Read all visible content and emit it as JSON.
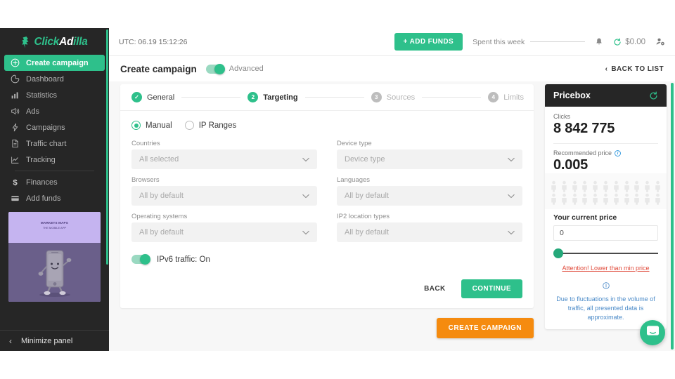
{
  "brand": {
    "accent": "#2ec08b",
    "orange": "#f58b0f",
    "dark": "#262626",
    "logo_click": "Click",
    "logo_ad": "Ad",
    "logo_illa": "illa"
  },
  "sidebar": {
    "items": [
      {
        "label": "Create campaign",
        "icon": "plus-circle-icon",
        "active": true
      },
      {
        "label": "Dashboard",
        "icon": "pie-chart-icon",
        "active": false
      },
      {
        "label": "Statistics",
        "icon": "bar-chart-icon",
        "active": false
      },
      {
        "label": "Ads",
        "icon": "megaphone-icon",
        "active": false
      },
      {
        "label": "Campaigns",
        "icon": "bolt-icon",
        "active": false
      },
      {
        "label": "Traffic chart",
        "icon": "document-icon",
        "active": false
      },
      {
        "label": "Tracking",
        "icon": "line-chart-icon",
        "active": false
      },
      {
        "label": "Finances",
        "icon": "dollar-icon",
        "active": false
      },
      {
        "label": "Add funds",
        "icon": "credit-card-icon",
        "active": false
      }
    ],
    "promo": {
      "line1": "MARKETS MAPS",
      "line2": "THE MOBILE APP"
    },
    "minimize_label": "Minimize panel"
  },
  "topbar": {
    "utc": "UTC: 06.19 15:12:26",
    "add_funds_label": "+ ADD FUNDS",
    "spent_label": "Spent this week",
    "spent_value": "",
    "balance": "$0.00",
    "bell_icon": "bell-icon",
    "refresh_icon": "refresh-icon",
    "account_icon": "account-settings-icon"
  },
  "pagehead": {
    "title": "Create campaign",
    "advanced_label": "Advanced",
    "advanced_on": true,
    "back_to_list": "BACK TO LIST"
  },
  "stepper": [
    {
      "num": "✓",
      "label": "General",
      "state": "done"
    },
    {
      "num": "2",
      "label": "Targeting",
      "state": "cur"
    },
    {
      "num": "3",
      "label": "Sources",
      "state": "idle"
    },
    {
      "num": "4",
      "label": "Limits",
      "state": "idle"
    }
  ],
  "form": {
    "mode_options": [
      {
        "label": "Manual",
        "selected": true
      },
      {
        "label": "IP Ranges",
        "selected": false
      }
    ],
    "fields": [
      {
        "label": "Countries",
        "value": "All selected"
      },
      {
        "label": "Device type",
        "value": "Device type"
      },
      {
        "label": "Browsers",
        "value": "All by default"
      },
      {
        "label": "Languages",
        "value": "All by default"
      },
      {
        "label": "Operating systems",
        "value": "All by default"
      },
      {
        "label": "IP2 location types",
        "value": "All by default"
      }
    ],
    "ipv6_label": "IPv6 traffic: On",
    "ipv6_on": true,
    "back_label": "BACK",
    "continue_label": "CONTINUE",
    "create_campaign_label": "CREATE CAMPAIGN"
  },
  "pricebox": {
    "title": "Pricebox",
    "refresh_icon": "refresh-icon",
    "clicks_label": "Clicks",
    "clicks_value": "8 842 775",
    "recommended_label": "Recommended price",
    "recommended_value": "0.005",
    "current_price_label": "Your current price",
    "current_price_value": "0",
    "warning": "Attention! Lower than min price",
    "note": "Due to fluctuations in the volume of traffic, all presented data is approximate."
  },
  "chat": {
    "icon": "chat-bubble-icon"
  }
}
